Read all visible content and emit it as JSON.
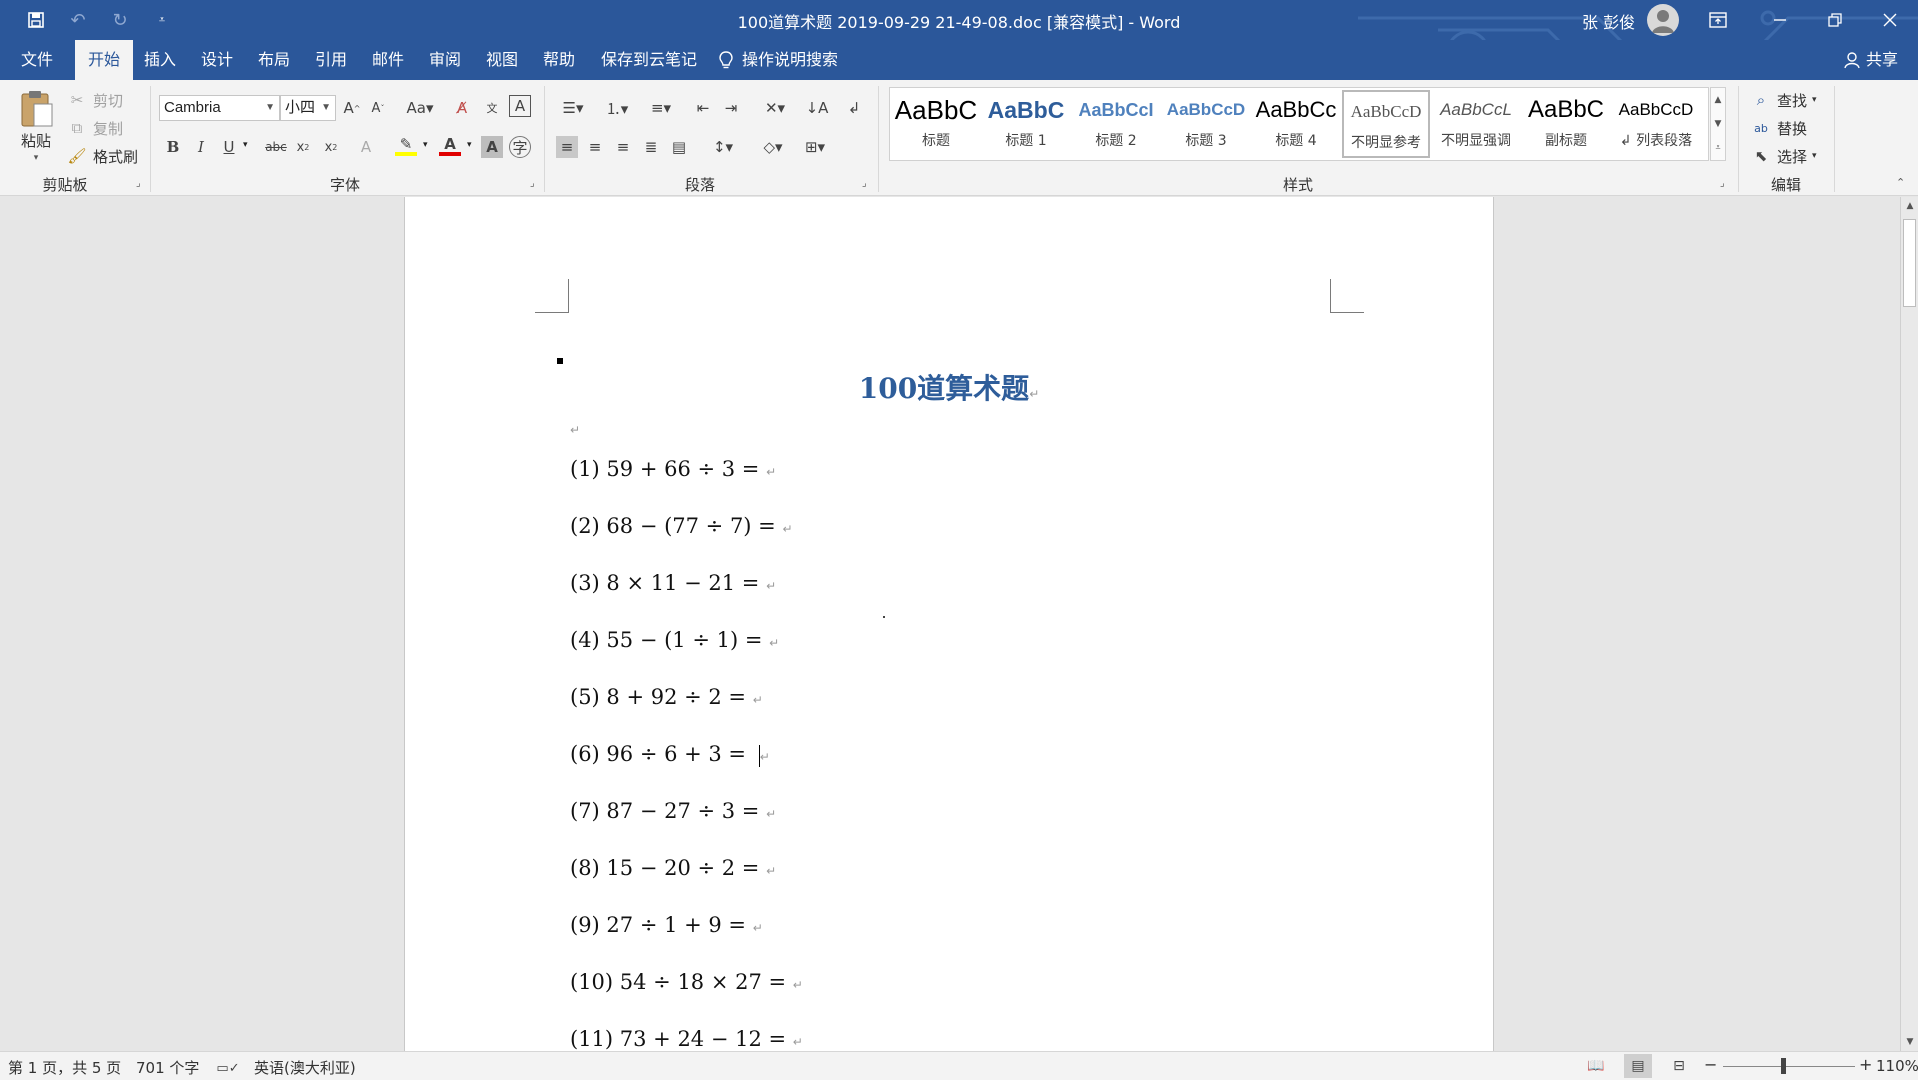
{
  "window": {
    "title": "100道算术题 2019-09-29 21-49-08.doc [兼容模式]  -  Word",
    "user": "张 彭俊",
    "accent": "#2b579a"
  },
  "qat": {
    "save_icon": "save-icon",
    "undo_icon": "undo-icon",
    "redo_icon": "redo-icon",
    "customize_icon": "customize-qat-icon"
  },
  "tabs": [
    {
      "label": "文件"
    },
    {
      "label": "开始"
    },
    {
      "label": "插入"
    },
    {
      "label": "设计"
    },
    {
      "label": "布局"
    },
    {
      "label": "引用"
    },
    {
      "label": "邮件"
    },
    {
      "label": "审阅"
    },
    {
      "label": "视图"
    },
    {
      "label": "帮助"
    },
    {
      "label": "保存到云笔记"
    }
  ],
  "active_tab": "开始",
  "tell_me": "操作说明搜索",
  "share": "共享",
  "ribbon": {
    "clipboard": {
      "paste": "粘贴",
      "cut": "剪切",
      "copy": "复制",
      "format_painter": "格式刷",
      "label": "剪贴板"
    },
    "font": {
      "name": "Cambria",
      "size": "小四",
      "label": "字体"
    },
    "paragraph": {
      "label": "段落"
    },
    "styles": {
      "label": "样式",
      "items": [
        {
          "sample": "AaBbC",
          "name": "标题"
        },
        {
          "sample": "AaBbC",
          "name": "标题 1"
        },
        {
          "sample": "AaBbCcI",
          "name": "标题 2"
        },
        {
          "sample": "AaBbCcD",
          "name": "标题 3"
        },
        {
          "sample": "AaBbCc",
          "name": "标题 4"
        },
        {
          "sample": "AaBbCcD",
          "name": "不明显参考"
        },
        {
          "sample": "AaBbCcL",
          "name": "不明显强调"
        },
        {
          "sample": "AaBbC",
          "name": "副标题"
        },
        {
          "sample": "AaBbCcD",
          "name": "↲ 列表段落"
        }
      ]
    },
    "editing": {
      "find": "查找",
      "replace": "替换",
      "select": "选择",
      "label": "编辑"
    }
  },
  "document": {
    "title": "100道算术题",
    "problems": [
      "(1)  59 + 66 ÷ 3  = ",
      "(2)  68 − (77 ÷ 7)  = ",
      "(3)  8 × 11 − 21  = ",
      "(4)  55 − (1 ÷ 1)  = ",
      "(5)  8 + 92 ÷ 2  = ",
      "(6)  96 ÷ 6 + 3  = ",
      "(7)  87 − 27 ÷ 3  = ",
      "(8)  15 − 20 ÷ 2  = ",
      "(9)  27 ÷ 1 + 9  = ",
      "(10)  54 ÷ 18 × 27  = ",
      "(11)  73 + 24 − 12  = "
    ]
  },
  "status": {
    "page": "第 1 页，共 5 页",
    "words": "701 个字",
    "language": "英语(澳大利亚)",
    "zoom": "110%"
  }
}
